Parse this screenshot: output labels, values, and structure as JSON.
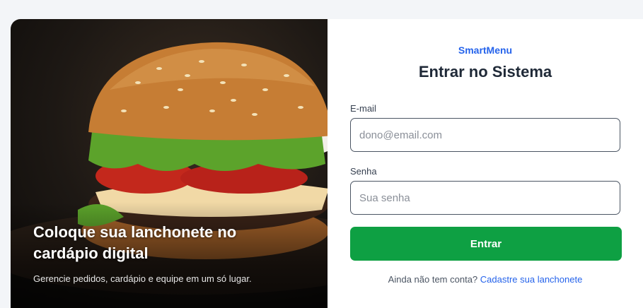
{
  "hero": {
    "image_alt": "burger-photo",
    "title": "Coloque sua lanchonete no cardápio digital",
    "subtitle": "Gerencie pedidos, cardápio e equipe em um só lugar."
  },
  "login": {
    "brand": "SmartMenu",
    "heading": "Entrar no Sistema",
    "email_label": "E-mail",
    "email_placeholder": "dono@email.com",
    "email_value": "",
    "password_label": "Senha",
    "password_placeholder": "Sua senha",
    "password_value": "",
    "submit_label": "Entrar",
    "no_account_text": "Ainda não tem conta?",
    "register_link": "Cadastre sua lanchonete"
  },
  "colors": {
    "brand": "#2563eb",
    "submit": "#0ea043",
    "heading": "#1f2937"
  }
}
